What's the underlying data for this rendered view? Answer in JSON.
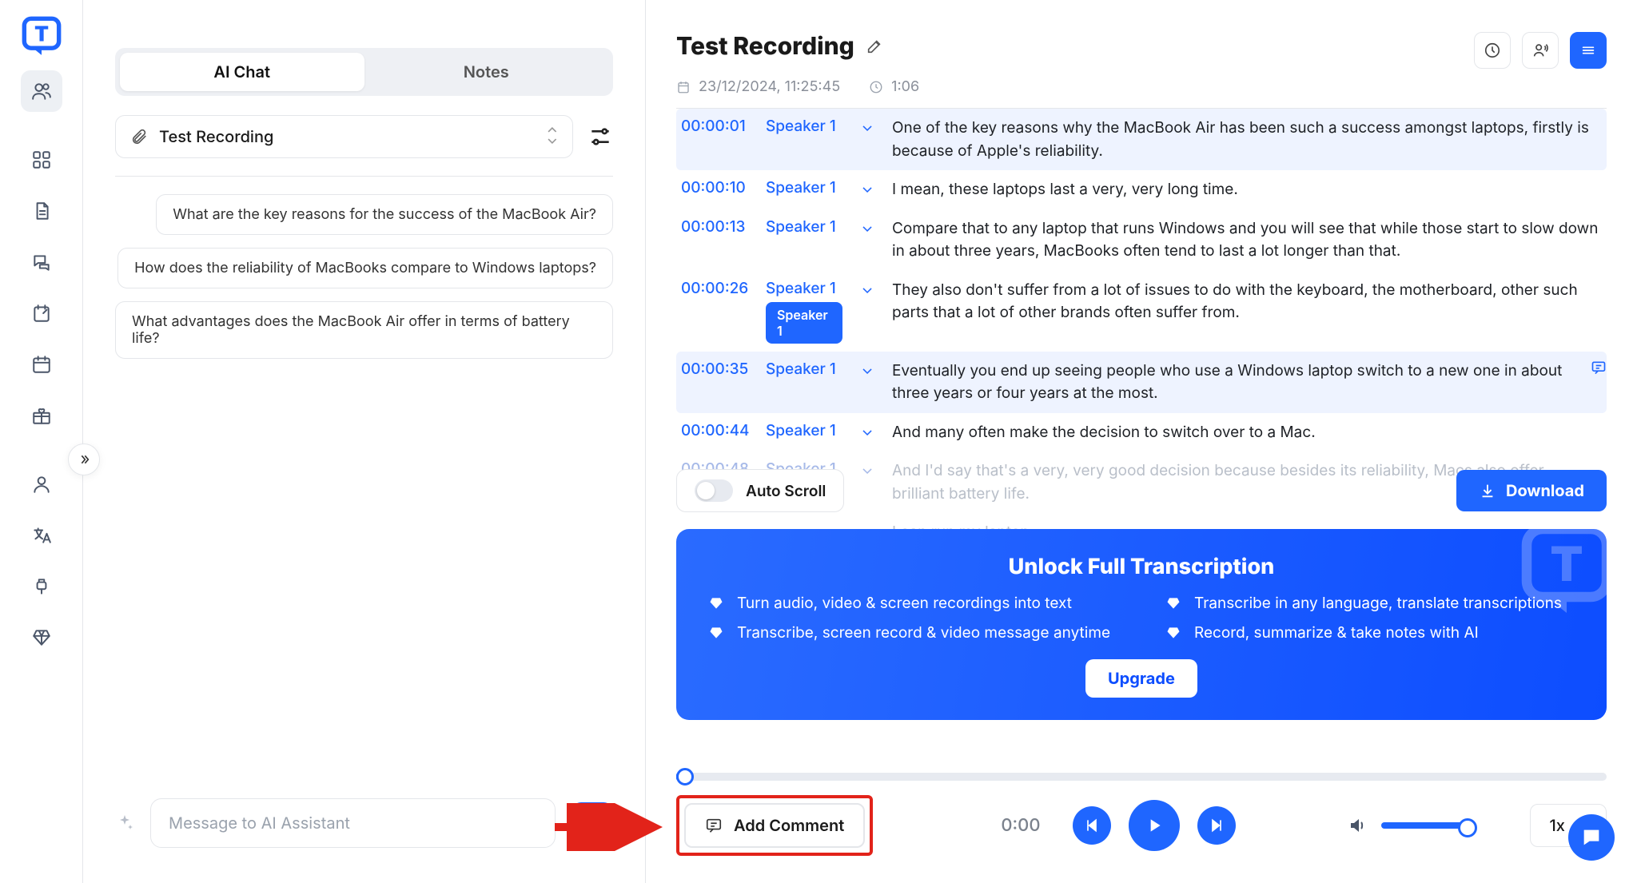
{
  "title": "Test Recording",
  "meta": {
    "date": "23/12/2024, 11:25:45",
    "duration": "1:06"
  },
  "tabs": {
    "ai_chat": "AI Chat",
    "notes": "Notes"
  },
  "attachment": "Test Recording",
  "suggestions": [
    "What are the key reasons for the success of the MacBook Air?",
    "How does the reliability of MacBooks compare to Windows laptops?",
    "What advantages does the MacBook Air offer in terms of battery life?"
  ],
  "message_placeholder": "Message to AI Assistant",
  "auto_scroll_label": "Auto Scroll",
  "download_label": "Download",
  "add_comment_label": "Add Comment",
  "player": {
    "current_time": "0:00",
    "speed": "1x"
  },
  "banner": {
    "title": "Unlock Full Transcription",
    "items": [
      "Turn audio, video & screen recordings into text",
      "Transcribe in any language, translate transcriptions",
      "Transcribe, screen record & video message anytime",
      "Record, summarize & take notes with AI"
    ],
    "cta": "Upgrade"
  },
  "speaker_tag": "Speaker 1",
  "transcript": [
    {
      "ts": "00:00:01",
      "spk": "Speaker 1",
      "txt": "One of the key reasons why the MacBook Air has been such a success amongst laptops, firstly is because of Apple's reliability.",
      "sel": true
    },
    {
      "ts": "00:00:10",
      "spk": "Speaker 1",
      "txt": "I mean, these laptops last a very, very long time."
    },
    {
      "ts": "00:00:13",
      "spk": "Speaker 1",
      "txt": "Compare that to any laptop that runs Windows and you will see that while those start to slow down in about three years, MacBooks often tend to last a lot longer than that."
    },
    {
      "ts": "00:00:26",
      "spk": "Speaker 1",
      "txt": "They also don't suffer from a lot of issues to do with the keyboard, the motherboard, other such parts that a lot of other brands often suffer from.",
      "tag": true
    },
    {
      "ts": "00:00:35",
      "spk": "Speaker 1",
      "txt": "Eventually you end up seeing people who use a Windows laptop switch to a new one in about three years or four years at the most.",
      "sel": true,
      "comment": true
    },
    {
      "ts": "00:00:44",
      "spk": "Speaker 1",
      "txt": "And many often make the decision to switch over to a Mac."
    },
    {
      "ts": "00:00:48",
      "spk": "Speaker 1",
      "txt": "And I'd say that's a very, very good decision because besides its reliability, Macs also offer brilliant battery life.",
      "faded": true
    },
    {
      "ts": "",
      "spk": "",
      "txt": "I can run my laptop.",
      "faded": true
    }
  ]
}
